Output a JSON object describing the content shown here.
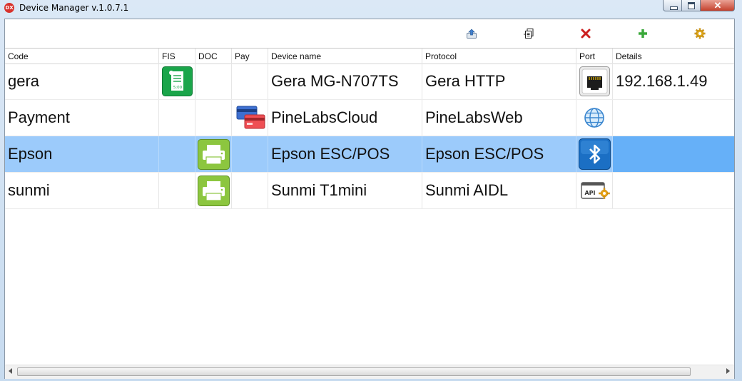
{
  "window": {
    "title": "Device Manager v.1.0.7.1",
    "app_icon_text": "DX"
  },
  "titlebar_controls": {
    "close_glyph": "✕"
  },
  "toolbar": {
    "buttons": [
      {
        "name": "export-icon"
      },
      {
        "name": "properties-icon"
      },
      {
        "name": "delete-icon",
        "color": "#cc1f1f"
      },
      {
        "name": "add-icon",
        "color": "#3aa83a"
      },
      {
        "name": "settings-icon",
        "color": "#e0a81a"
      }
    ]
  },
  "grid": {
    "columns": [
      "Code",
      "FIS",
      "DOC",
      "Pay",
      "Device name",
      "Protocol",
      "Port",
      "Details"
    ],
    "rows": [
      {
        "code": "gera",
        "fis": "fiscal-receipt-icon",
        "doc": "",
        "pay": "",
        "device_name": "Gera MG-N707TS",
        "protocol": "Gera HTTP",
        "port": "ethernet-port-icon",
        "details": "192.168.1.49",
        "selected": false
      },
      {
        "code": "Payment",
        "fis": "",
        "doc": "",
        "pay": "payment-cards-icon",
        "device_name": "PineLabsCloud",
        "protocol": "PineLabsWeb",
        "port": "globe-icon",
        "details": "",
        "selected": false
      },
      {
        "code": "Epson",
        "fis": "",
        "doc": "printer-icon",
        "pay": "",
        "device_name": "Epson ESC/POS",
        "protocol": "Epson ESC/POS",
        "port": "bluetooth-icon",
        "details": "",
        "selected": true
      },
      {
        "code": "sunmi",
        "fis": "",
        "doc": "printer-icon",
        "pay": "",
        "device_name": "Sunmi T1mini",
        "protocol": "Sunmi AIDL",
        "port": "api-icon",
        "details": "",
        "selected": false
      }
    ],
    "fis_receipt_text": "5:00",
    "api_text": "API"
  },
  "colors": {
    "selection": "#9ccbfb",
    "selection_focus": "#66b0f8",
    "doc_green": "#8cc63f",
    "fis_green": "#1aa54a",
    "bluetooth_blue": "#1b6fc4"
  }
}
